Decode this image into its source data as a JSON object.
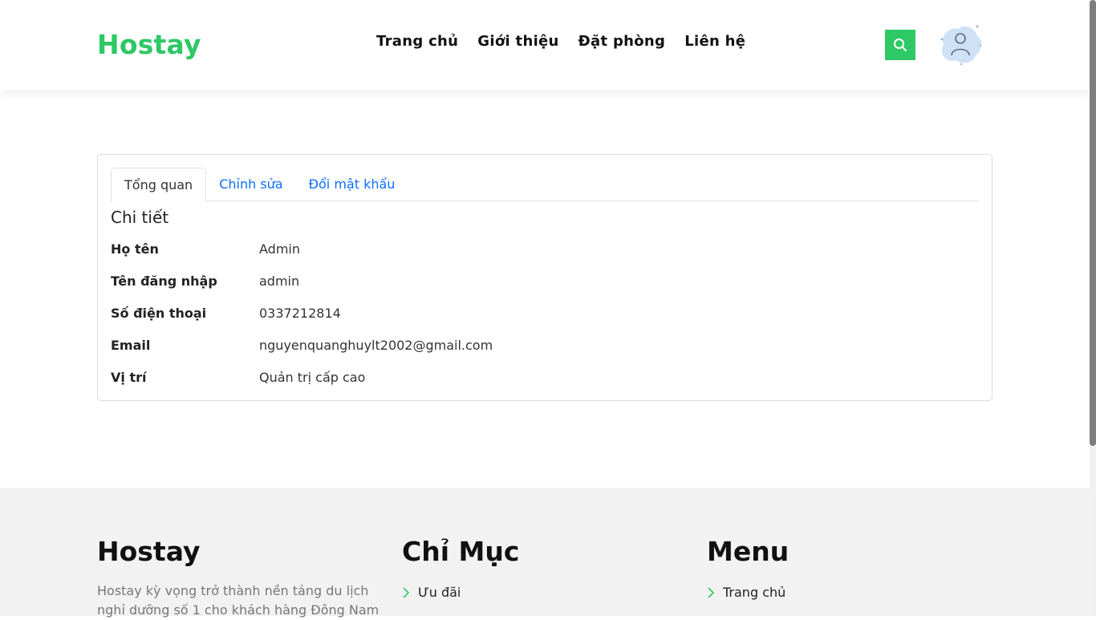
{
  "header": {
    "logo": "Hostay",
    "nav": [
      "Trang chủ",
      "Giới thiệu",
      "Đặt phòng",
      "Liên hệ"
    ]
  },
  "profile": {
    "tabs": [
      "Tổng quan",
      "Chỉnh sửa",
      "Đổi mật khẩu"
    ],
    "active_tab": "Tổng quan",
    "section_title": "Chi tiết",
    "fields": [
      {
        "label": "Họ tên",
        "value": "Admin"
      },
      {
        "label": "Tên đăng nhập",
        "value": "admin"
      },
      {
        "label": "Số điện thoại",
        "value": "0337212814"
      },
      {
        "label": "Email",
        "value": "nguyenquanghuylt2002@gmail.com"
      },
      {
        "label": "Vị trí",
        "value": "Quản trị cấp cao"
      }
    ]
  },
  "footer": {
    "col1": {
      "title": "Hostay",
      "description": "Hostay kỳ vọng trở thành nền tảng du lịch nghỉ dưỡng số 1 cho khách hàng Đông Nam"
    },
    "col2": {
      "title": "Chỉ Mục",
      "links": [
        "Ưu đãi"
      ]
    },
    "col3": {
      "title": "Menu",
      "links": [
        "Trang chủ"
      ]
    }
  },
  "colors": {
    "brand": "#2ec866",
    "link": "#0d6efd"
  }
}
